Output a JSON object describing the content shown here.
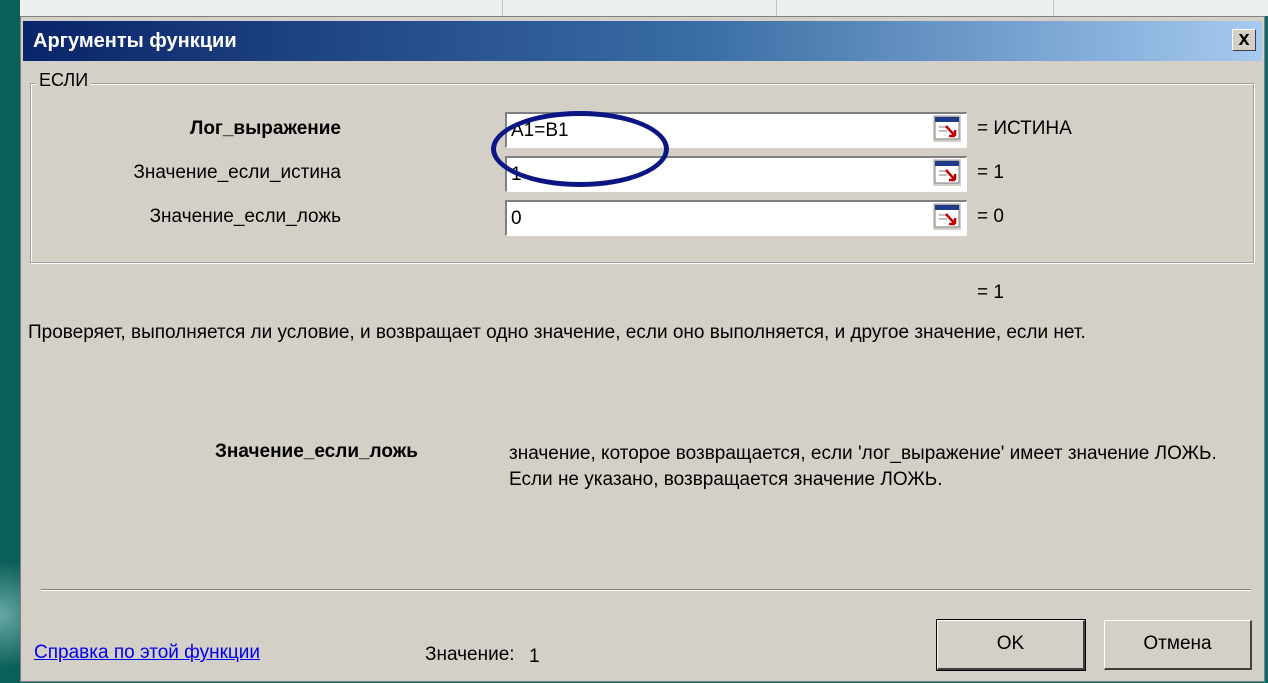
{
  "dialog": {
    "title": "Аргументы функции",
    "close_symbol": "x"
  },
  "function_group": {
    "name": "ЕСЛИ"
  },
  "arguments": [
    {
      "label": "Лог_выражение",
      "value": "A1=B1",
      "result": "= ИСТИНА",
      "bold": true
    },
    {
      "label": "Значение_если_истина",
      "value": "1",
      "result": "= 1",
      "bold": false
    },
    {
      "label": "Значение_если_ложь",
      "value": "0",
      "result": "= 0",
      "bold": false
    }
  ],
  "formula_result": "= 1",
  "description": "Проверяет, выполняется ли условие, и возвращает одно значение, если оно выполняется, и другое значение, если нет.",
  "argument_help": {
    "name": "Значение_если_ложь",
    "text": "значение, которое возвращается, если 'лог_выражение' имеет значение ЛОЖЬ. Если не указано, возвращается значение ЛОЖЬ."
  },
  "footer": {
    "help_link": "Справка по этой функции",
    "value_label": "Значение:",
    "value": "1",
    "ok_label": "OK",
    "cancel_label": "Отмена"
  },
  "colors": {
    "titlebar_start": "#0a246a",
    "titlebar_end": "#a6caf0",
    "dialog_bg": "#d4d0c8",
    "highlight_ellipse": "#0c1584",
    "slide_bg": "#0b6b62"
  }
}
